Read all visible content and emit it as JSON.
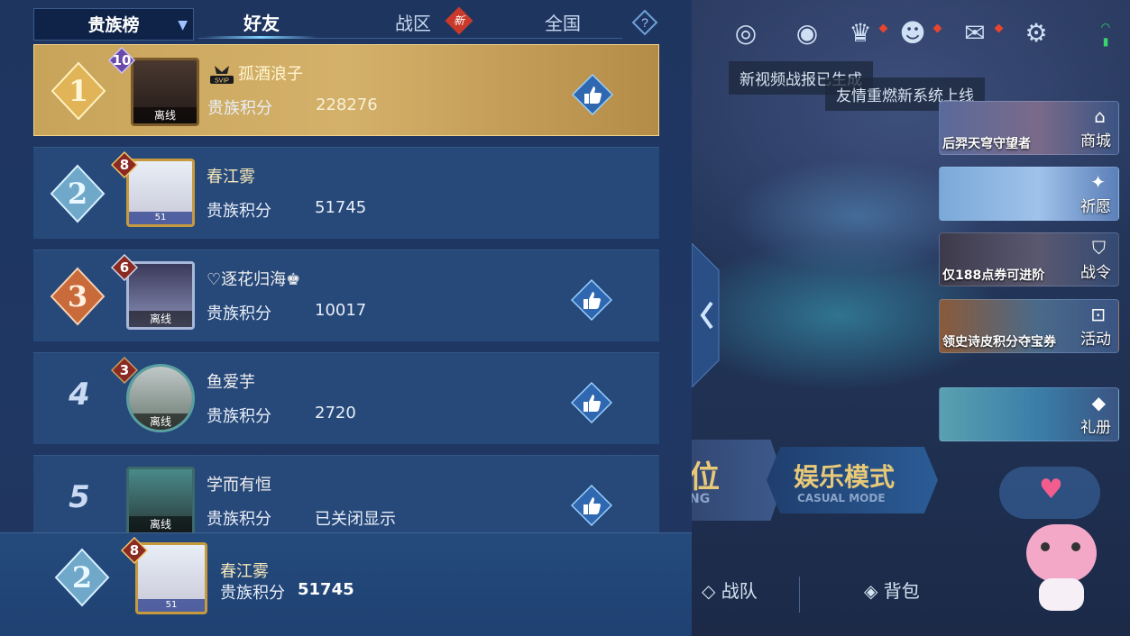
{
  "tabs": {
    "dropdown_label": "贵族榜",
    "friends": "好友",
    "zone": "战区",
    "zone_badge": "新",
    "national": "全国",
    "help_icon": "question-mark-icon"
  },
  "leaderboard": [
    {
      "rank": "1",
      "level": "10",
      "name": "孤酒浪子",
      "label": "贵族积分",
      "score": "228276",
      "status": "离线",
      "svip": "SVIP",
      "highlight": true,
      "like": true
    },
    {
      "rank": "2",
      "level": "8",
      "name": "春江雾",
      "label": "贵族积分",
      "score": "51745",
      "status": "51",
      "like": false
    },
    {
      "rank": "3",
      "level": "6",
      "name": "♡逐花归海♚",
      "label": "贵族积分",
      "score": "10017",
      "status": "离线",
      "like": true
    },
    {
      "rank": "4",
      "level": "3",
      "name": "鱼爱芋",
      "label": "贵族积分",
      "score": "2720",
      "status": "离线",
      "like": true
    },
    {
      "rank": "5",
      "level": "",
      "name": "学而有恒",
      "label": "贵族积分",
      "score": "已关闭显示",
      "status": "离线",
      "like": true
    }
  ],
  "my_rank": {
    "rank": "2",
    "level": "8",
    "name": "春江雾",
    "label": "贵族积分",
    "score": "51745",
    "status": "51"
  },
  "background": {
    "notices": [
      "新视频战报已生成",
      "友情重燃新系统上线"
    ],
    "side_cards": [
      {
        "caption": "后羿天穹守望者",
        "label": "商城",
        "icon": "shop-icon"
      },
      {
        "caption": "",
        "label": "祈愿",
        "icon": "star-icon"
      },
      {
        "caption": "仅188点券可进阶",
        "label": "战令",
        "icon": "shield-icon"
      },
      {
        "caption": "领史诗皮积分夺宝券",
        "label": "活动",
        "icon": "gift-icon"
      },
      {
        "caption": "",
        "label": "礼册",
        "icon": "book-icon"
      }
    ],
    "mode_left": "位",
    "mode_left_sub": "NG",
    "mode_right": "娱乐模式",
    "mode_right_sub": "CASUAL MODE",
    "bottom_links": [
      "战队",
      "背包"
    ]
  },
  "colors": {
    "gold": "#d4b16a",
    "row": "#27497a",
    "panel": "#1f3763",
    "badge_red": "#c93a2a"
  }
}
